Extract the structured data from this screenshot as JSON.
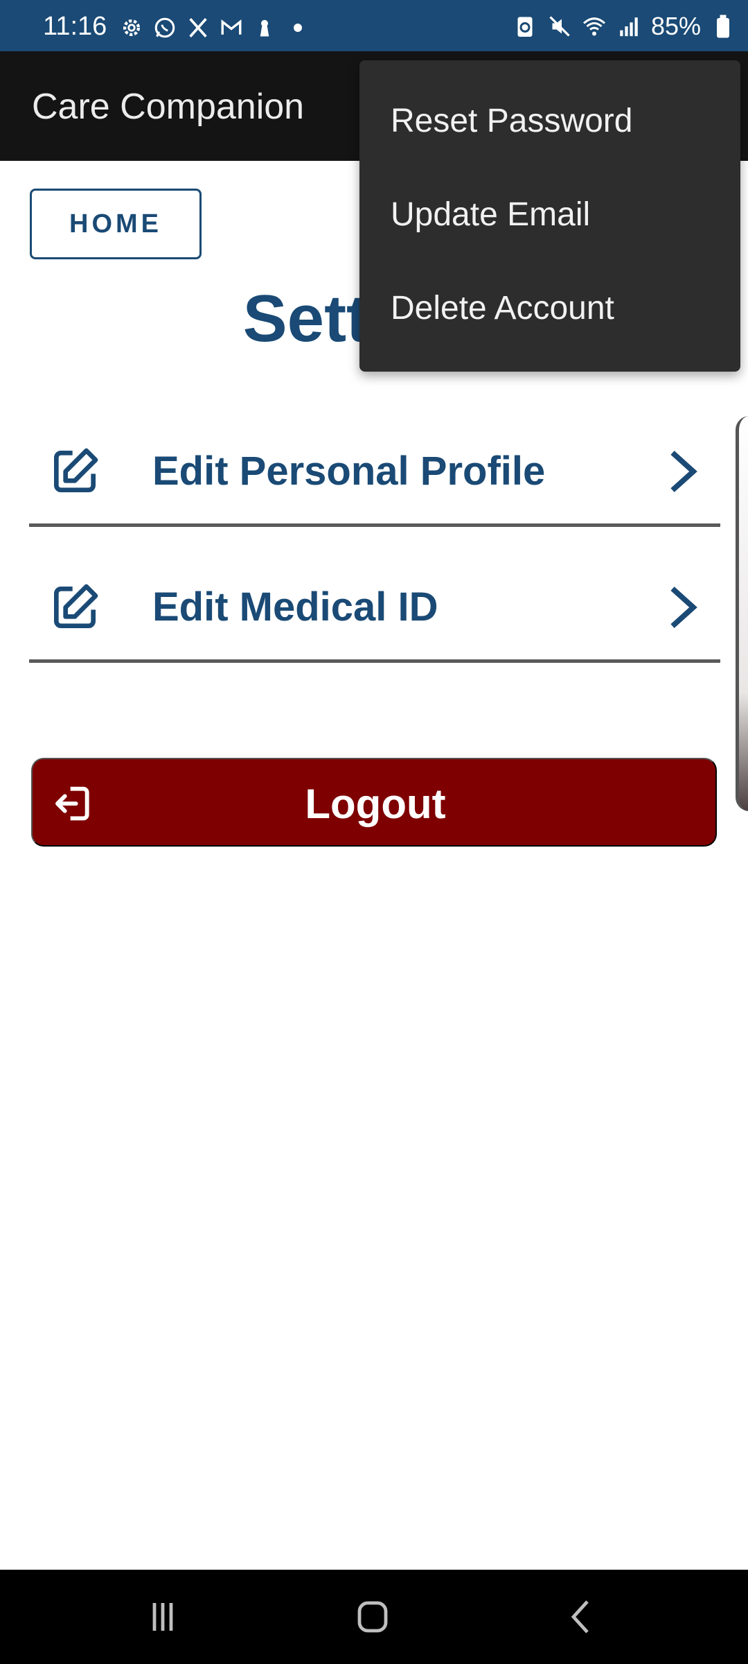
{
  "status_bar": {
    "time": "11:16",
    "battery": "85%",
    "left_icons": [
      "settings-gear-icon",
      "whatsapp-icon",
      "x-twitter-icon",
      "gmail-icon",
      "keyhole-icon",
      "dot-icon"
    ],
    "right_icons": [
      "battery-saver-icon",
      "mute-icon",
      "wifi-icon",
      "signal-icon",
      "battery-icon"
    ]
  },
  "app_bar": {
    "title": "Care Companion"
  },
  "home_button": {
    "label": "HOME"
  },
  "page_heading": "Settings",
  "settings_rows": [
    {
      "label": "Edit Personal Profile",
      "icon": "edit-icon"
    },
    {
      "label": "Edit Medical ID",
      "icon": "edit-icon"
    }
  ],
  "logout_button": {
    "label": "Logout",
    "icon": "logout-icon"
  },
  "menu": {
    "items": [
      {
        "label": "Reset Password"
      },
      {
        "label": "Update Email"
      },
      {
        "label": "Delete Account"
      }
    ]
  },
  "nav_bar": {
    "icons": [
      "recent-apps-icon",
      "home-nav-icon",
      "back-icon"
    ]
  },
  "colors": {
    "primary": "#1a4a75",
    "status_bar": "#1a4a75",
    "app_bar": "#141414",
    "logout": "#7e0000",
    "menu_bg": "#2d2d2d"
  }
}
